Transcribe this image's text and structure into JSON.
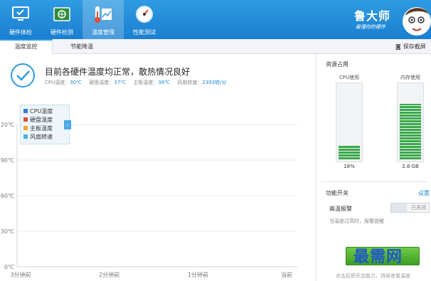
{
  "nav": [
    {
      "label": "硬件体检",
      "icon": "monitor-check-icon",
      "active": false
    },
    {
      "label": "硬件检测",
      "icon": "circuit-board-icon",
      "active": false
    },
    {
      "label": "温度管理",
      "icon": "thermometer-chart-icon",
      "active": true
    },
    {
      "label": "性能测试",
      "icon": "speedometer-icon",
      "active": false
    }
  ],
  "brand": {
    "title": "鲁大师",
    "slogan": "最懂你的硬件"
  },
  "tabs": [
    {
      "label": "温度监控",
      "active": true
    },
    {
      "label": "节能降温",
      "active": false
    }
  ],
  "save_label": "保存截屏",
  "status": {
    "title": "目前各硬件温度均正常，散热情况良好",
    "items": [
      {
        "label": "CPU温度：",
        "value": "30℃"
      },
      {
        "label": "硬盘温度：",
        "value": "37℃"
      },
      {
        "label": "主板温度：",
        "value": "38℃"
      },
      {
        "label": "风扇转速：",
        "value": "2393转/分"
      }
    ]
  },
  "chart_data": {
    "type": "line",
    "y_ticks": [
      "120℃",
      "90℃",
      "60℃",
      "30℃",
      "0℃"
    ],
    "x_ticks": [
      "3分钟前",
      "2分钟前",
      "1分钟前",
      "当前"
    ],
    "legend": [
      {
        "name": "CPU温度",
        "color": "#2f7fd6"
      },
      {
        "name": "硬盘温度",
        "color": "#e04b3b"
      },
      {
        "name": "主板温度",
        "color": "#f0a826"
      },
      {
        "name": "风扇转速",
        "color": "#46b3e6"
      }
    ],
    "series": [],
    "grid": true,
    "legend_position": "top-left"
  },
  "resources": {
    "title": "资源占用",
    "cpu": {
      "label": "CPU使用",
      "value": "18%",
      "fraction": 0.18
    },
    "memory": {
      "label": "内存使用",
      "value": "2.8 GB",
      "fraction": 0.75
    }
  },
  "functions": {
    "title": "功能开关",
    "settings_label": "设置",
    "alarm": {
      "label": "高温报警",
      "state": "已关闭",
      "desc": "当温度过高时，报警提醒"
    }
  },
  "bottom_hint": "点击后即开启能力，持续查看温度",
  "watermark": "最需网",
  "colors": {
    "accent": "#2f9be3",
    "bar_green": "#3aa84a",
    "link": "#1a8ad4"
  }
}
